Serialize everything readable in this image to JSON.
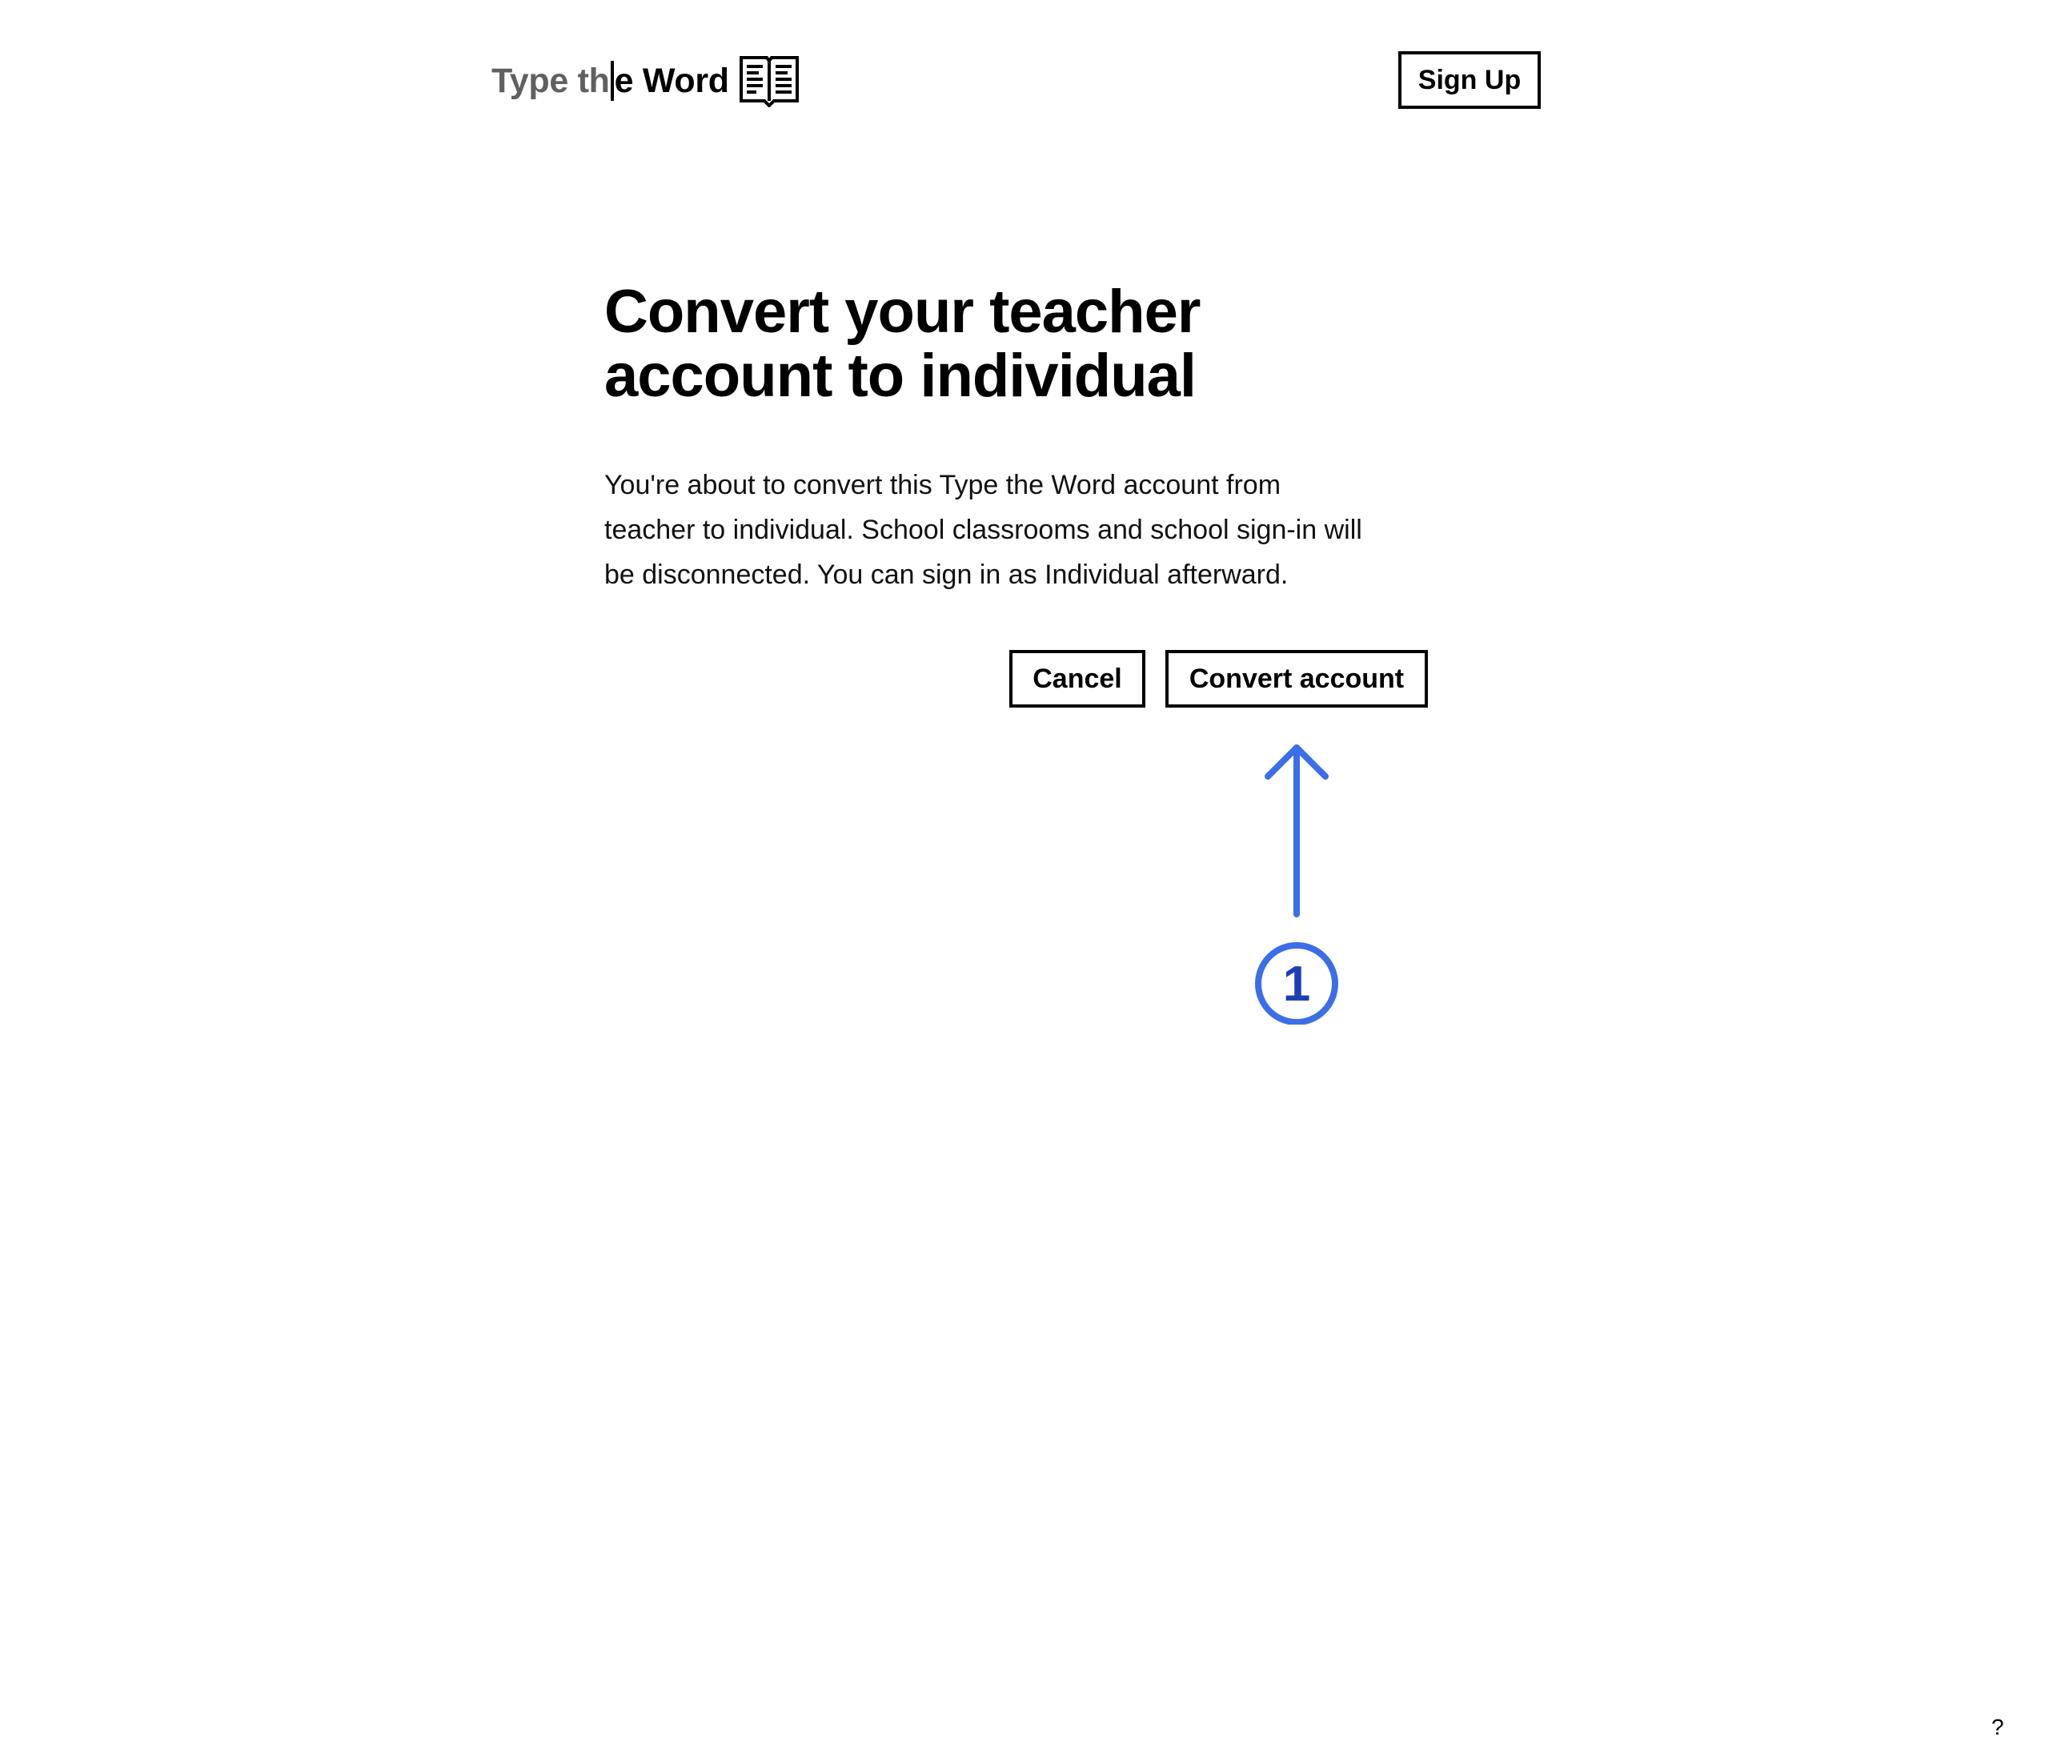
{
  "header": {
    "logo": {
      "text_grey": "Type th",
      "text_dark": "e Word",
      "icon": "open-book-icon"
    },
    "signup_label": "Sign Up"
  },
  "main": {
    "title_line1": "Convert your teacher",
    "title_line2": "account to individual",
    "description_line1": "You're about to convert this Type the Word account from",
    "description_line2": "teacher to individual. School classrooms and school sign-in will",
    "description_line3": "be disconnected. You can sign in as Individual afterward.",
    "cancel_label": "Cancel",
    "convert_label": "Convert account"
  },
  "annotation": {
    "step_number": "1",
    "icon": "up-arrow-icon",
    "color": "#3b6ee8"
  },
  "help_label": "?"
}
